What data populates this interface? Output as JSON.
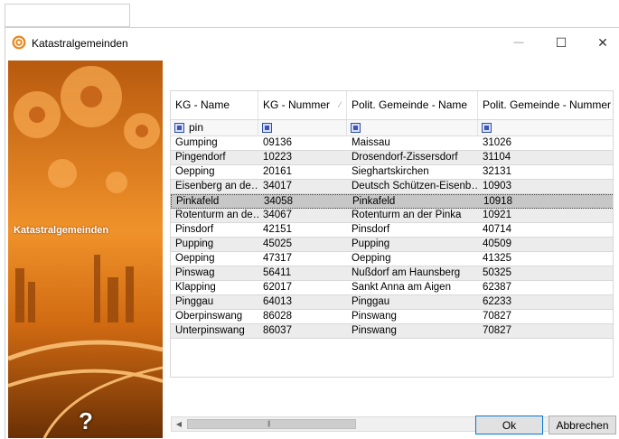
{
  "window": {
    "title": "Katastralgemeinden",
    "minimize": "—",
    "maximize": "☐",
    "close": "✕"
  },
  "side_panel": {
    "label": "Katastralgemeinden",
    "help_glyph": "?"
  },
  "grid": {
    "columns": [
      "KG - Name",
      "KG - Nummer",
      "Polit. Gemeinde - Name",
      "Polit. Gemeinde - Nummer"
    ],
    "sort_glyph": "⁄",
    "filter_value": "pin",
    "rows": [
      [
        "Gumping",
        "09136",
        "Maissau",
        "31026"
      ],
      [
        "Pingendorf",
        "10223",
        "Drosendorf-Zissersdorf",
        "31104"
      ],
      [
        "Oepping",
        "20161",
        "Sieghartskirchen",
        "32131"
      ],
      [
        "Eisenberg an de…",
        "34017",
        "Deutsch Schützen-Eisenb…",
        "10903"
      ],
      [
        "Pinkafeld",
        "34058",
        "Pinkafeld",
        "10918"
      ],
      [
        "Rotenturm an de…",
        "34067",
        "Rotenturm an der Pinka",
        "10921"
      ],
      [
        "Pinsdorf",
        "42151",
        "Pinsdorf",
        "40714"
      ],
      [
        "Pupping",
        "45025",
        "Pupping",
        "40509"
      ],
      [
        "Oepping",
        "47317",
        "Oepping",
        "41325"
      ],
      [
        "Pinswag",
        "56411",
        "Nußdorf am Haunsberg",
        "50325"
      ],
      [
        "Klapping",
        "62017",
        "Sankt Anna am Aigen",
        "62387"
      ],
      [
        "Pinggau",
        "64013",
        "Pinggau",
        "62233"
      ],
      [
        "Oberpinswang",
        "86028",
        "Pinswang",
        "70827"
      ],
      [
        "Unterpinswang",
        "86037",
        "Pinswang",
        "70827"
      ]
    ],
    "selected_row_index": 4
  },
  "scrollbar": {
    "left_arrow": "◀",
    "right_arrow": "▶",
    "grip": "|||"
  },
  "buttons": {
    "ok": "Ok",
    "cancel": "Abbrechen"
  },
  "colors": {
    "side_panel_orange": "#e07a1a",
    "selected_row": "#c7c7c7",
    "alt_row": "#ececec",
    "ok_border": "#0078d7"
  }
}
